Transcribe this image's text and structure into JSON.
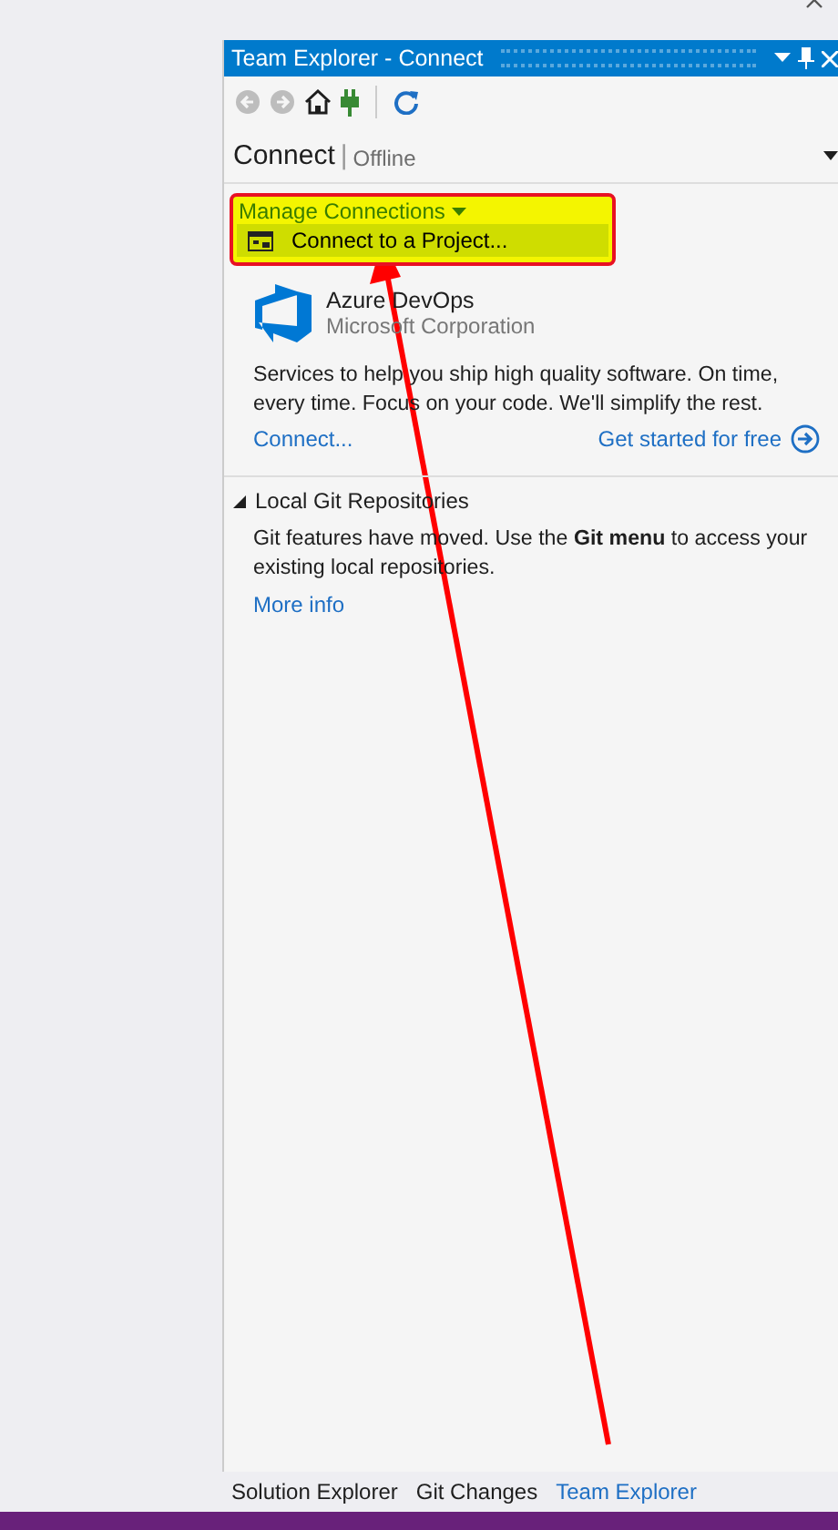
{
  "window": {
    "title": "Team Explorer - Connect"
  },
  "toolbar": [
    {
      "kind": "back",
      "disabled": true
    },
    {
      "kind": "forward",
      "disabled": true
    },
    {
      "kind": "home",
      "disabled": false
    },
    {
      "kind": "plug",
      "disabled": false
    },
    {
      "kind": "refresh",
      "disabled": false
    }
  ],
  "header": {
    "title": "Connect",
    "separator": "|",
    "status": "Offline"
  },
  "manage_connections": {
    "label": "Manage Connections",
    "expanded": true,
    "menu_items": [
      {
        "label": "Connect to a Project...",
        "selected": true
      }
    ]
  },
  "provider": {
    "name": "Azure DevOps",
    "publisher": "Microsoft Corporation",
    "description": "Services to help you ship high quality software. On time, every time. Focus on your code. We'll simplify the rest.",
    "links": [
      {
        "label": "Connect..."
      },
      {
        "label": "Get started for free"
      }
    ]
  },
  "local_git": {
    "title": "Local Git Repositories",
    "expanded": true,
    "text": "Git features have moved. Use the **Git menu** to access your existing local repositories.",
    "link": "More info"
  },
  "tabs": [
    {
      "label": "Solution Explorer",
      "selected": false
    },
    {
      "label": "Git Changes",
      "selected": false
    },
    {
      "label": "Team Explorer",
      "selected": true
    }
  ]
}
